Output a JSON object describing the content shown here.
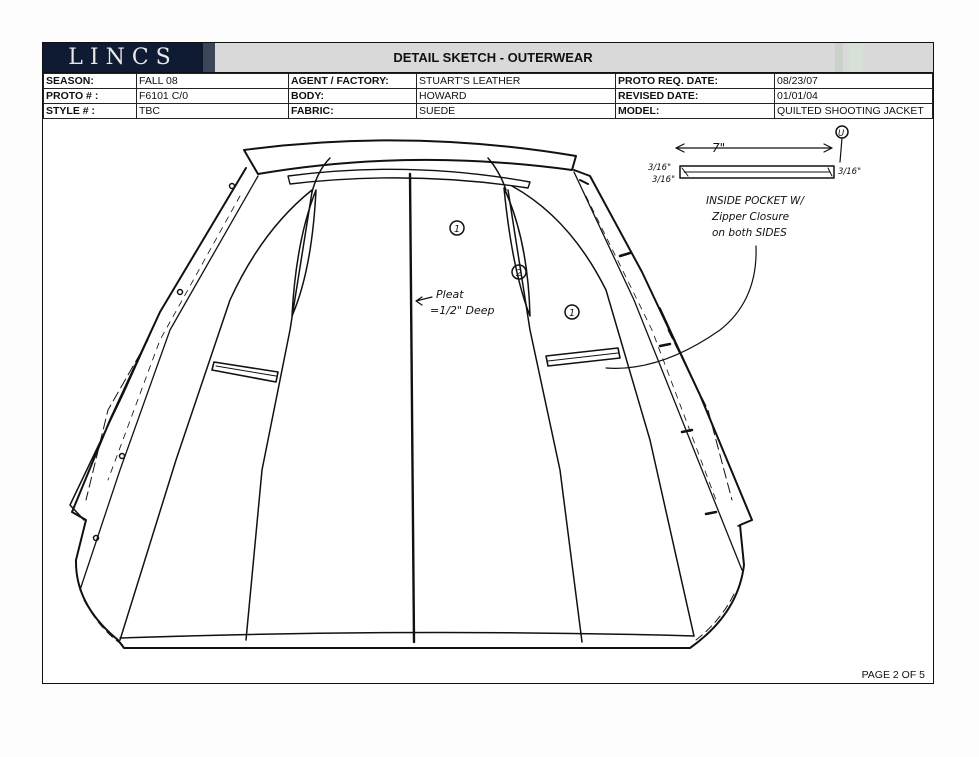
{
  "header": {
    "logo": "LINCS",
    "title": "DETAIL SKETCH - OUTERWEAR"
  },
  "info": {
    "season_label": "SEASON:",
    "season": "FALL 08",
    "agent_label": "AGENT / FACTORY:",
    "agent": "STUART'S LEATHER",
    "proto_req_label": "PROTO REQ. DATE:",
    "proto_req": "08/23/07",
    "proto_label": "PROTO # :",
    "proto": "F6101 C/0",
    "body_label": "BODY:",
    "body": "HOWARD",
    "revised_label": "REVISED DATE:",
    "revised": "01/01/04",
    "style_label": "STYLE # :",
    "style": "TBC",
    "fabric_label": "FABRIC:",
    "fabric": "SUEDE",
    "model_label": "MODEL:",
    "model": "QUILTED SHOOTING JACKET"
  },
  "annotations": {
    "dim_7": "7\"",
    "dim_3_16_a": "3/16\"",
    "dim_3_16_b": "3/16\"",
    "dim_3_16_c": "3/16\"",
    "note_line1": "INSIDE POCKET W/",
    "note_line2": "Zipper Closure",
    "note_line3": "on both SIDES",
    "pleat_line1": "Pleat",
    "pleat_line2": "=1/2\" Deep",
    "marker_1a": "1",
    "marker_1b": "1",
    "marker_2": "2",
    "marker_u": "U"
  },
  "footer": {
    "page": "PAGE 2 OF 5"
  }
}
